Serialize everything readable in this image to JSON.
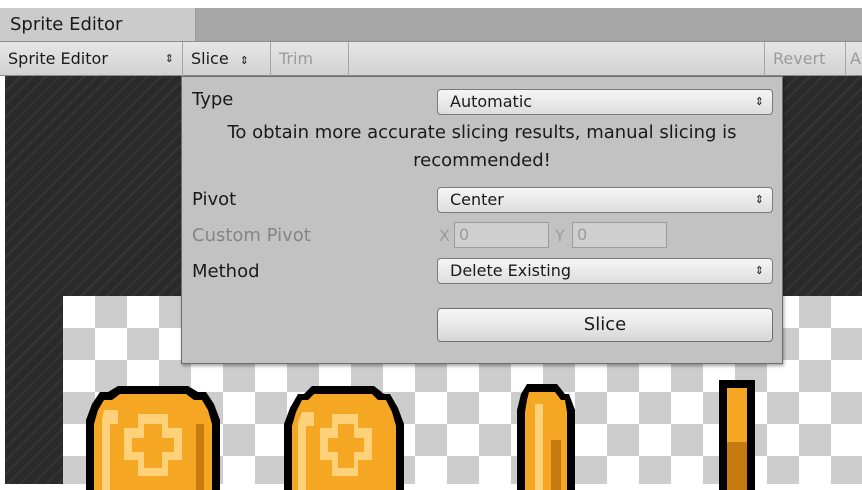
{
  "window": {
    "tab_title": "Sprite Editor"
  },
  "toolbar": {
    "mode_label": "Sprite Editor",
    "slice_label": "Slice",
    "trim_label": "Trim",
    "revert_label": "Revert",
    "apply_label": "A"
  },
  "slice_popup": {
    "type": {
      "label": "Type",
      "value": "Automatic"
    },
    "warning": "To obtain more accurate slicing results, manual slicing is recommended!",
    "pivot": {
      "label": "Pivot",
      "value": "Center"
    },
    "custom_pivot": {
      "label": "Custom Pivot",
      "x_label": "X",
      "x_value": "0",
      "y_label": "Y",
      "y_value": "0"
    },
    "method": {
      "label": "Method",
      "value": "Delete Existing"
    },
    "slice_button": "Slice"
  },
  "colors": {
    "coin_fill": "#f5a623",
    "coin_highlight": "#ffd27a",
    "coin_shade": "#c77a10",
    "coin_outline": "#000000"
  },
  "icons": [
    "dropdown-arrows-icon"
  ]
}
